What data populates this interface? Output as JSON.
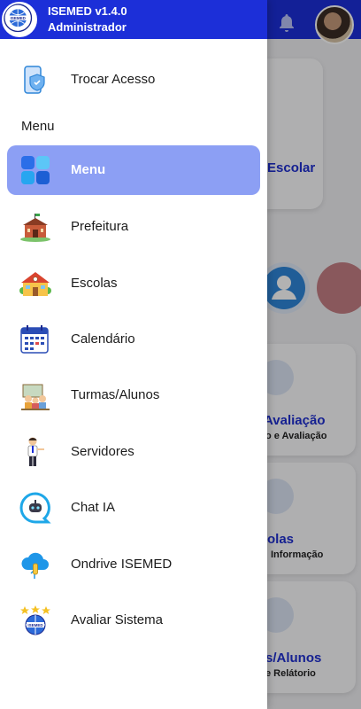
{
  "app": {
    "title": "ISEMED v1.4.0",
    "role": "Administrador"
  },
  "drawer": {
    "switch_access": "Trocar Acesso",
    "section_label": "Menu",
    "items": [
      {
        "label": "Menu",
        "icon": "grid-icon",
        "active": true
      },
      {
        "label": "Prefeitura",
        "icon": "city-hall-icon"
      },
      {
        "label": "Escolas",
        "icon": "school-icon"
      },
      {
        "label": "Calendário",
        "icon": "calendar-icon"
      },
      {
        "label": "Turmas/Alunos",
        "icon": "classroom-icon"
      },
      {
        "label": "Servidores",
        "icon": "staff-icon"
      },
      {
        "label": "Chat IA",
        "icon": "chat-bot-icon"
      },
      {
        "label": "Ondrive ISEMED",
        "icon": "cloud-icon"
      },
      {
        "label": "Avaliar Sistema",
        "icon": "rating-icon"
      }
    ]
  },
  "background": {
    "card_escolar": "Escolar",
    "card_avaliacao_title": "Avaliação",
    "card_avaliacao_sub": "o e Avaliação",
    "card_escolas_title": "olas",
    "card_escolas_sub": "Informação",
    "card_turmas_title": "s/Alunos",
    "card_turmas_sub": "e Relátorio"
  },
  "colors": {
    "header": "#1c2fd8",
    "active_item": "#8c9ff4",
    "accent_text": "#1f2fd0"
  }
}
